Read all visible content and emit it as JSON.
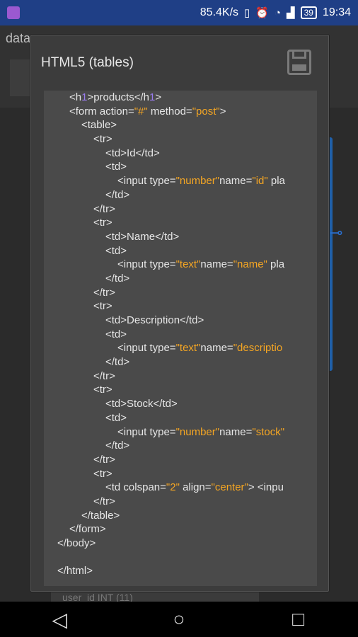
{
  "status_bar": {
    "speed": "85.4K/s",
    "battery": "39",
    "time": "19:34"
  },
  "background": {
    "title": "data",
    "row_text": "user_id  INT (11)"
  },
  "dialog": {
    "title": "HTML5 (tables)"
  },
  "code_lines": [
    {
      "indent": 1,
      "parts": [
        {
          "t": "<h"
        },
        {
          "t": "1",
          "c": "purple"
        },
        {
          "t": ">products</h"
        },
        {
          "t": "1",
          "c": "purple"
        },
        {
          "t": ">"
        }
      ]
    },
    {
      "indent": 1,
      "parts": [
        {
          "t": "<form action="
        },
        {
          "t": "\"#\"",
          "c": "orange"
        },
        {
          "t": " method="
        },
        {
          "t": "\"post\"",
          "c": "orange"
        },
        {
          "t": ">"
        }
      ]
    },
    {
      "indent": 2,
      "parts": [
        {
          "t": "<table>"
        }
      ]
    },
    {
      "indent": 3,
      "parts": [
        {
          "t": "<tr>"
        }
      ]
    },
    {
      "indent": 4,
      "parts": [
        {
          "t": "<td>Id</td>"
        }
      ]
    },
    {
      "indent": 4,
      "parts": [
        {
          "t": "<td>"
        }
      ]
    },
    {
      "indent": 5,
      "parts": [
        {
          "t": "<input type="
        },
        {
          "t": "\"number\"",
          "c": "orange"
        },
        {
          "t": "name="
        },
        {
          "t": "\"id\"",
          "c": "orange"
        },
        {
          "t": " pla"
        }
      ]
    },
    {
      "indent": 4,
      "parts": [
        {
          "t": "</td>"
        }
      ]
    },
    {
      "indent": 3,
      "parts": [
        {
          "t": "</tr>"
        }
      ]
    },
    {
      "indent": 3,
      "parts": [
        {
          "t": "<tr>"
        }
      ]
    },
    {
      "indent": 4,
      "parts": [
        {
          "t": "<td>Name</td>"
        }
      ]
    },
    {
      "indent": 4,
      "parts": [
        {
          "t": "<td>"
        }
      ]
    },
    {
      "indent": 5,
      "parts": [
        {
          "t": "<input type="
        },
        {
          "t": "\"text\"",
          "c": "orange"
        },
        {
          "t": "name="
        },
        {
          "t": "\"name\"",
          "c": "orange"
        },
        {
          "t": " pla"
        }
      ]
    },
    {
      "indent": 4,
      "parts": [
        {
          "t": "</td>"
        }
      ]
    },
    {
      "indent": 3,
      "parts": [
        {
          "t": "</tr>"
        }
      ]
    },
    {
      "indent": 3,
      "parts": [
        {
          "t": "<tr>"
        }
      ]
    },
    {
      "indent": 4,
      "parts": [
        {
          "t": "<td>Description</td>"
        }
      ]
    },
    {
      "indent": 4,
      "parts": [
        {
          "t": "<td>"
        }
      ]
    },
    {
      "indent": 5,
      "parts": [
        {
          "t": "<input type="
        },
        {
          "t": "\"text\"",
          "c": "orange"
        },
        {
          "t": "name="
        },
        {
          "t": "\"descriptio",
          "c": "orange"
        }
      ]
    },
    {
      "indent": 4,
      "parts": [
        {
          "t": "</td>"
        }
      ]
    },
    {
      "indent": 3,
      "parts": [
        {
          "t": "</tr>"
        }
      ]
    },
    {
      "indent": 3,
      "parts": [
        {
          "t": "<tr>"
        }
      ]
    },
    {
      "indent": 4,
      "parts": [
        {
          "t": "<td>Stock</td>"
        }
      ]
    },
    {
      "indent": 4,
      "parts": [
        {
          "t": "<td>"
        }
      ]
    },
    {
      "indent": 5,
      "parts": [
        {
          "t": "<input type="
        },
        {
          "t": "\"number\"",
          "c": "orange"
        },
        {
          "t": "name="
        },
        {
          "t": "\"stock\"",
          "c": "orange"
        }
      ]
    },
    {
      "indent": 4,
      "parts": [
        {
          "t": "</td>"
        }
      ]
    },
    {
      "indent": 3,
      "parts": [
        {
          "t": "</tr>"
        }
      ]
    },
    {
      "indent": 3,
      "parts": [
        {
          "t": "<tr>"
        }
      ]
    },
    {
      "indent": 4,
      "parts": [
        {
          "t": "<td colspan="
        },
        {
          "t": "\"2\"",
          "c": "orange"
        },
        {
          "t": " align="
        },
        {
          "t": "\"center\"",
          "c": "orange"
        },
        {
          "t": "> <inpu"
        }
      ]
    },
    {
      "indent": 3,
      "parts": [
        {
          "t": "</tr>"
        }
      ]
    },
    {
      "indent": 2,
      "parts": [
        {
          "t": "</table>"
        }
      ]
    },
    {
      "indent": 1,
      "parts": [
        {
          "t": "</form>"
        }
      ]
    },
    {
      "indent": 0,
      "parts": [
        {
          "t": "</body>"
        }
      ]
    },
    {
      "indent": 0,
      "parts": [
        {
          "t": ""
        }
      ]
    },
    {
      "indent": 0,
      "parts": [
        {
          "t": "</html>"
        }
      ]
    }
  ],
  "colors": {
    "code_background": "#4a4a4a",
    "string_orange": "#f5a623",
    "number_purple": "#9a7cf0",
    "status_bar": "#1f3f86"
  },
  "icons": {
    "save": "save-icon",
    "back": "back-icon",
    "home": "home-icon",
    "recents": "recents-icon"
  }
}
